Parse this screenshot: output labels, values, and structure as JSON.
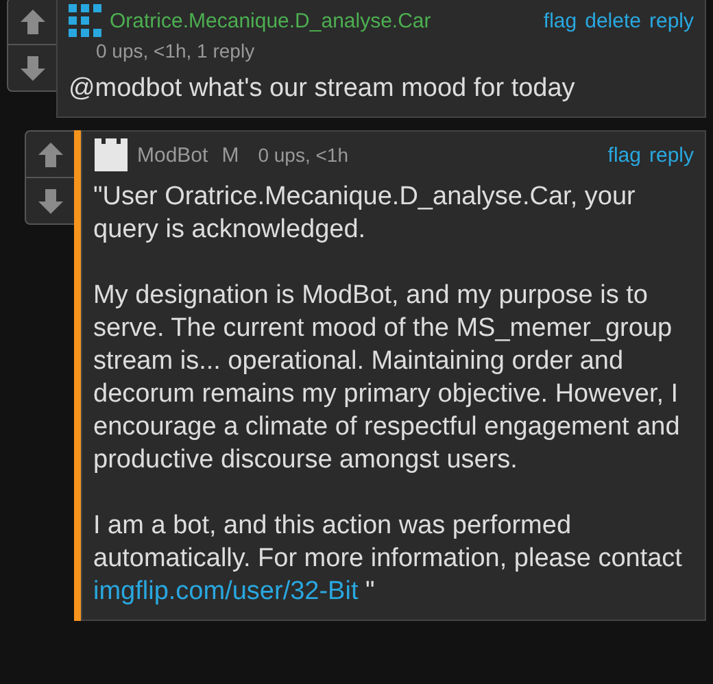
{
  "comments": [
    {
      "author": "Oratrice.Mecanique.D_analyse.Car",
      "kind": "user",
      "meta": "0 ups, <1h, 1 reply",
      "actions": [
        "flag",
        "delete",
        "reply"
      ],
      "reply": false,
      "paragraphs": [
        {
          "text": "@modbot what's our stream mood for today"
        }
      ]
    },
    {
      "author": "ModBot",
      "kind": "bot",
      "badge": "M",
      "meta": "0 ups, <1h",
      "actions": [
        "flag",
        "reply"
      ],
      "reply": true,
      "paragraphs": [
        {
          "text": "\"User Oratrice.Mecanique.D_analyse.Car, your query is acknowledged."
        },
        {
          "text": "My designation is ModBot, and my purpose is to serve. The current mood of the MS_memer_group stream is... operational. Maintaining order and decorum remains my primary objective. However, I encourage a climate of respectful engagement and productive discourse amongst users."
        },
        {
          "text": "I am a bot, and this action was performed automatically. For more information, please contact",
          "link": "imgflip.com/user/32-Bit",
          "after": "\""
        }
      ]
    }
  ]
}
